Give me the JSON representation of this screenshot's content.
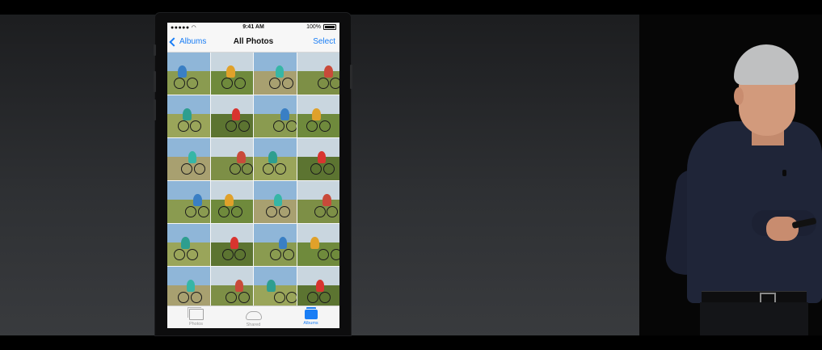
{
  "status_bar": {
    "carrier_signal": "●●●●●",
    "time": "9:41 AM",
    "battery": "100%"
  },
  "nav": {
    "back_label": "Albums",
    "title": "All Photos",
    "select_label": "Select"
  },
  "tabs": [
    {
      "label": "Photos",
      "icon": "photos-icon",
      "active": false
    },
    {
      "label": "Shared",
      "icon": "cloud-icon",
      "active": false
    },
    {
      "label": "Albums",
      "icon": "albums-icon",
      "active": true
    }
  ],
  "colors": {
    "accent": "#1a7ef5",
    "screen_bg": "#f7f7f7"
  }
}
